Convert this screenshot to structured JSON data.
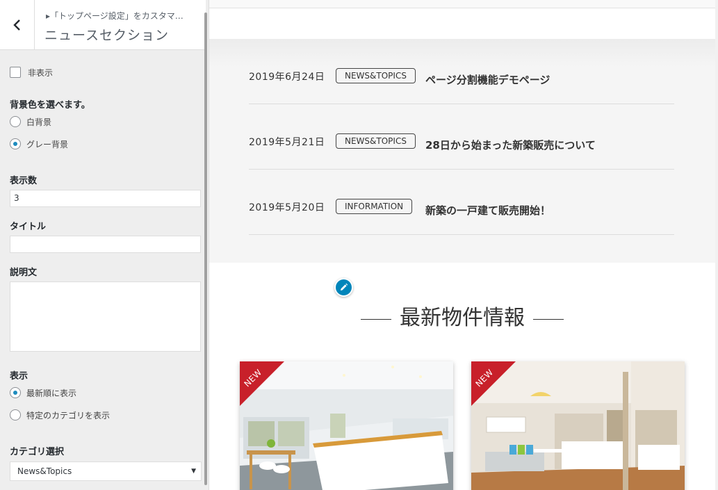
{
  "sidebar": {
    "breadcrumb": "▸「トップページ設定」をカスタマ…",
    "section_title": "ニュースセクション",
    "hide_checkbox_label": "非表示",
    "bg_color_label": "背景色を選べます。",
    "bg_options": [
      "白背景",
      "グレー背景"
    ],
    "bg_selected": "グレー背景",
    "count_label": "表示数",
    "count_value": "3",
    "title_label": "タイトル",
    "title_value": "",
    "description_label": "説明文",
    "description_value": "",
    "display_label": "表示",
    "display_options": [
      "最新順に表示",
      "特定のカテゴリを表示"
    ],
    "display_selected": "最新順に表示",
    "category_label": "カテゴリ選択",
    "category_value": "News&Topics"
  },
  "preview": {
    "news": [
      {
        "date": "2019年6月24日",
        "tag": "NEWS&TOPICS",
        "title": "ページ分割機能デモページ"
      },
      {
        "date": "2019年5月21日",
        "tag": "NEWS&TOPICS",
        "title": "28日から始まった新築販売について"
      },
      {
        "date": "2019年5月20日",
        "tag": "INFORMATION",
        "title": "新築の一戸建て販売開始！"
      }
    ],
    "properties_heading": "最新物件情報",
    "badge_label": "NEW"
  },
  "colors": {
    "accent": "#0085ba",
    "ribbon": "#c8202a",
    "news_bg": "#f5f5f5",
    "sidebar_bg": "#eeeeee"
  }
}
